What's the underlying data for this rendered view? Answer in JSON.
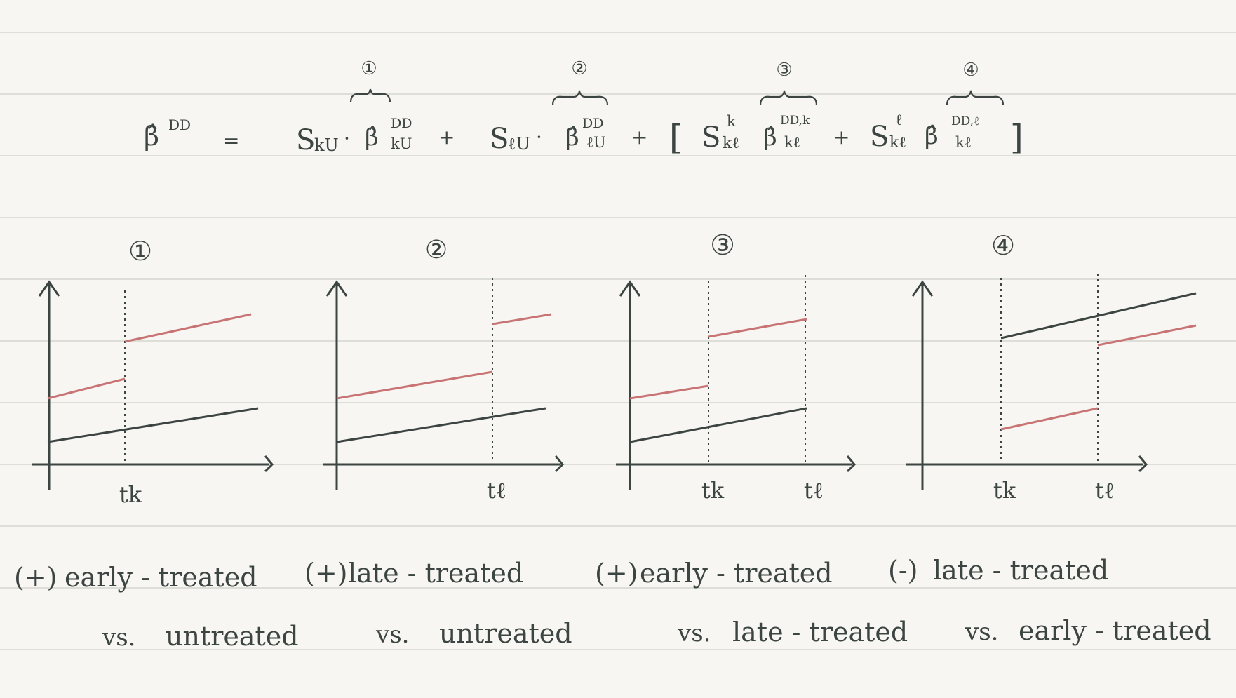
{
  "colors": {
    "paper": "#f7f6f2",
    "ruling": "#d6d5d0",
    "ink": "#3d4543",
    "treated": "#c97474"
  },
  "equation": {
    "lhs": "β̂",
    "lhs_sup": "DD",
    "equals": "=",
    "terms": [
      {
        "num": "①",
        "weight": "S",
        "weight_sub": "kU",
        "weight_sup": "",
        "dot": "·",
        "beta": "β̂",
        "beta_sup": "DD",
        "beta_sub": "kU",
        "plus": "+"
      },
      {
        "num": "②",
        "weight": "S",
        "weight_sub": "ℓU",
        "weight_sup": "",
        "dot": "·",
        "beta": "β̂",
        "beta_sup": "DD",
        "beta_sub": "ℓU",
        "plus": "+"
      },
      {
        "num": "③",
        "weight": "S",
        "weight_sub": "kℓ",
        "weight_sup": "k",
        "dot": "",
        "beta": "β̂",
        "beta_sup": "DD,k",
        "beta_sub": "kℓ",
        "plus": "+"
      },
      {
        "num": "④",
        "weight": "S",
        "weight_sub": "kℓ",
        "weight_sup": "ℓ",
        "dot": "",
        "beta": "β̂",
        "beta_sup": "DD,ℓ",
        "beta_sub": "kℓ",
        "plus": ""
      }
    ],
    "open_bracket": "[",
    "close_bracket": "]"
  },
  "panels": [
    {
      "number": "①",
      "tick_labels": [
        "tk"
      ],
      "sign": "(+)",
      "sign_color": "ink",
      "caption_line1": "early - treated",
      "caption_line2_vs": "vs.",
      "caption_line2": "untreated"
    },
    {
      "number": "②",
      "tick_labels": [
        "tℓ"
      ],
      "sign": "(+)",
      "sign_color": "ink",
      "caption_line1": "late - treated",
      "caption_line2_vs": "vs.",
      "caption_line2": "untreated"
    },
    {
      "number": "③",
      "tick_labels": [
        "tk",
        "tℓ"
      ],
      "sign": "(+)",
      "sign_color": "ink",
      "caption_line1": "early - treated",
      "caption_line2_vs": "vs.",
      "caption_line2": "late - treated"
    },
    {
      "number": "④",
      "tick_labels": [
        "tk",
        "tℓ"
      ],
      "sign": "(-)",
      "sign_color": "treated",
      "caption_line1": "late - treated",
      "caption_line2_vs": "vs.",
      "caption_line2": "early - treated"
    }
  ]
}
